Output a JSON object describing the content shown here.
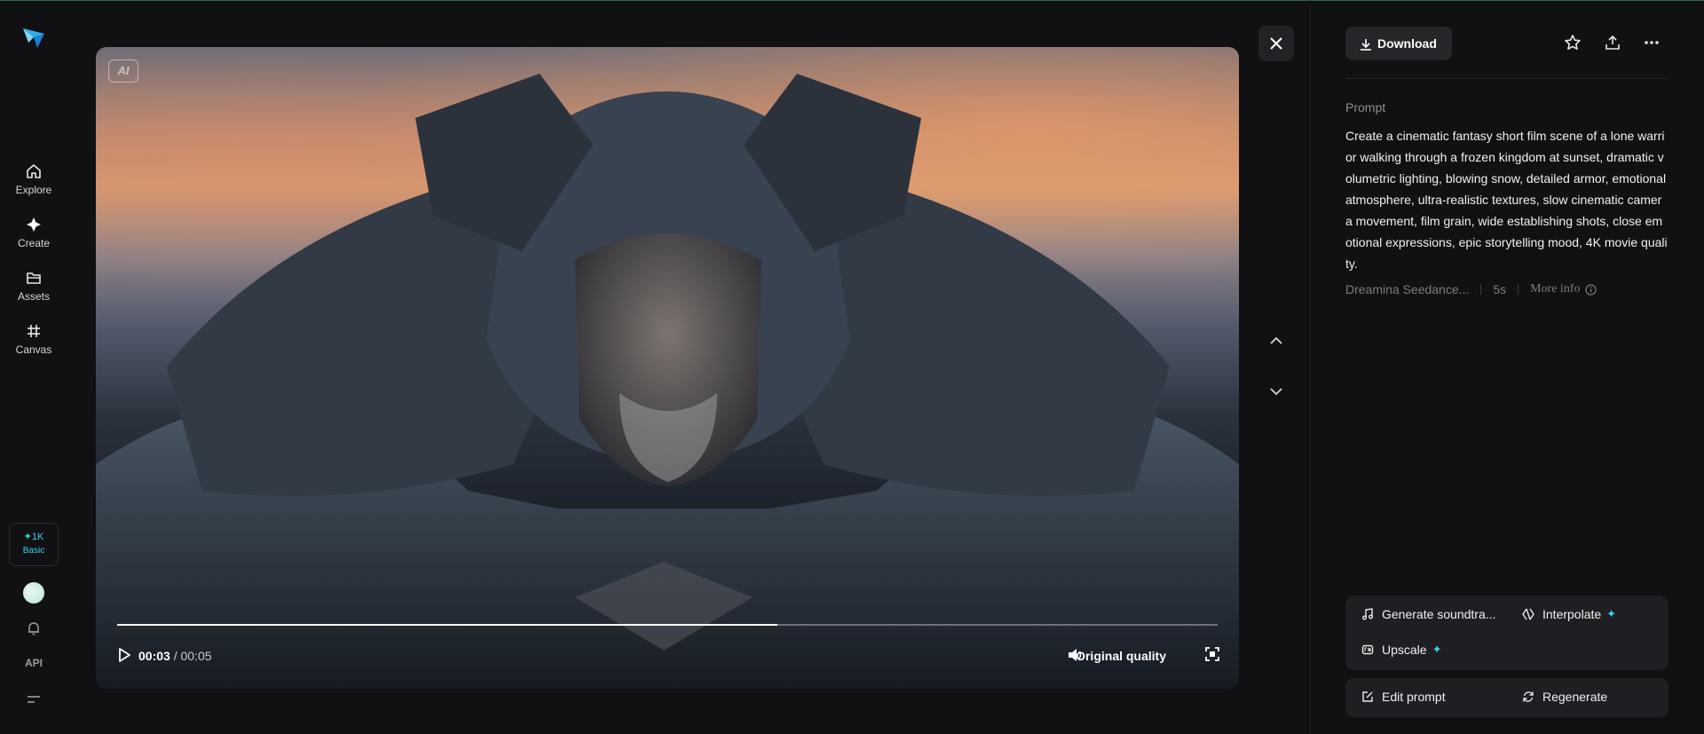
{
  "colors": {
    "accent": "#35d5e8",
    "background": "#111113",
    "panel": "#1f1f23"
  },
  "nav": {
    "items": [
      {
        "label": "Explore",
        "icon": "home-icon"
      },
      {
        "label": "Create",
        "icon": "sparkle-icon"
      },
      {
        "label": "Assets",
        "icon": "folder-icon"
      },
      {
        "label": "Canvas",
        "icon": "canvas-icon"
      }
    ],
    "credits": {
      "value": "✦1K",
      "plan": "Basic"
    },
    "api_label": "API"
  },
  "video": {
    "ai_badge": "AI",
    "current_time": "00:03",
    "separator": " / ",
    "duration": "00:05",
    "progress_fraction": 0.6,
    "quality_label": "Original quality"
  },
  "panel": {
    "download_label": "Download",
    "prompt_label": "Prompt",
    "prompt_text": "Create a cinematic fantasy short film scene of a lone warrior walking through a frozen kingdom at sunset, dramatic volumetric lighting, blowing snow, detailed armor, emotional atmosphere, ultra-realistic textures, slow cinematic camera movement, film grain, wide establishing shots, close emotional expressions, epic storytelling mood, 4K movie quality.",
    "model": "Dreamina Seedance...",
    "length": "5s",
    "more_info": "More info",
    "tools": {
      "soundtrack": "Generate soundtra...",
      "interpolate": "Interpolate",
      "upscale": "Upscale",
      "spark": "✦"
    },
    "actions": {
      "edit_prompt": "Edit prompt",
      "regenerate": "Regenerate"
    }
  }
}
